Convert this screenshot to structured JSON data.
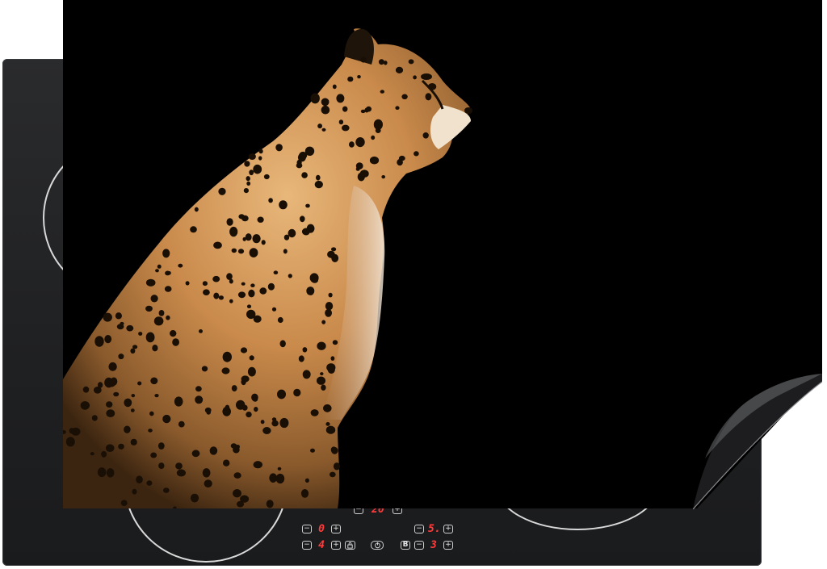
{
  "photo": {
    "subject": "cheetah",
    "background_color": "#000000"
  },
  "hob": {
    "surface_color": "#1f2022",
    "zone_ring_color": "#d9d9d9",
    "display_color": "#ff3b3b",
    "top_display": {
      "minus": "−",
      "value": "20",
      "plus": "+"
    },
    "controls": [
      {
        "minus": "−",
        "value": "0",
        "plus": "+"
      },
      {
        "minus": "−",
        "value": "4",
        "plus": "+",
        "lock_icon": "lock-icon"
      },
      {
        "minus": "−",
        "value": "5.",
        "plus": "+"
      },
      {
        "minus": "−",
        "value": "3",
        "plus": "+",
        "power_icon": "power-icon",
        "boost_label": "B"
      }
    ]
  }
}
